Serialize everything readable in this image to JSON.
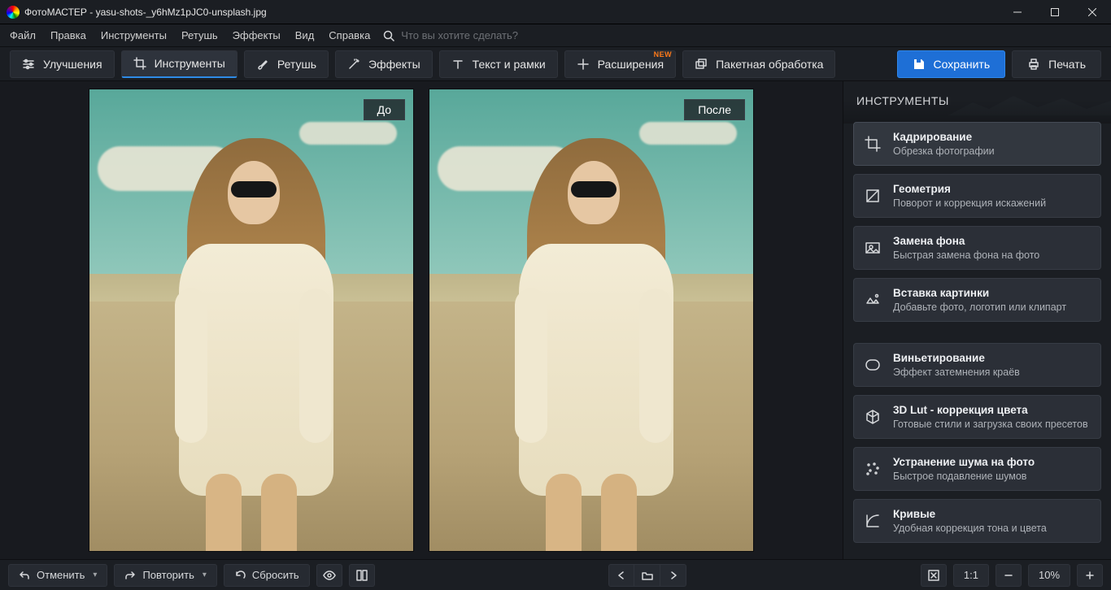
{
  "app": {
    "title": "ФотоМАСТЕР - yasu-shots-_y6hMz1pJC0-unsplash.jpg"
  },
  "menu": {
    "items": [
      "Файл",
      "Правка",
      "Инструменты",
      "Ретушь",
      "Эффекты",
      "Вид",
      "Справка"
    ],
    "search_placeholder": "Что вы хотите сделать?"
  },
  "toolbar": {
    "tabs": [
      {
        "id": "enhance",
        "label": "Улучшения"
      },
      {
        "id": "tools",
        "label": "Инструменты",
        "active": true
      },
      {
        "id": "retouch",
        "label": "Ретушь"
      },
      {
        "id": "effects",
        "label": "Эффекты"
      },
      {
        "id": "textframes",
        "label": "Текст и рамки"
      },
      {
        "id": "extensions",
        "label": "Расширения",
        "badge": "NEW"
      },
      {
        "id": "batch",
        "label": "Пакетная обработка"
      }
    ],
    "save": "Сохранить",
    "print": "Печать"
  },
  "canvas": {
    "before_label": "До",
    "after_label": "После"
  },
  "panel": {
    "heading": "ИНСТРУМЕНТЫ",
    "cards": [
      {
        "id": "crop",
        "title": "Кадрирование",
        "sub": "Обрезка фотографии",
        "active": true,
        "group": 0,
        "icon": "crop"
      },
      {
        "id": "geometry",
        "title": "Геометрия",
        "sub": "Поворот и коррекция искажений",
        "group": 0,
        "icon": "geometry"
      },
      {
        "id": "replace-bg",
        "title": "Замена фона",
        "sub": "Быстрая замена фона на фото",
        "group": 0,
        "icon": "replace-bg"
      },
      {
        "id": "insert-image",
        "title": "Вставка картинки",
        "sub": "Добавьте фото, логотип или клипарт",
        "group": 0,
        "icon": "insert-image"
      },
      {
        "id": "vignette",
        "title": "Виньетирование",
        "sub": "Эффект затемнения краёв",
        "group": 1,
        "icon": "vignette"
      },
      {
        "id": "3dlut",
        "title": "3D Lut - коррекция цвета",
        "sub": "Готовые стили и загрузка своих пресетов",
        "group": 1,
        "icon": "3dlut"
      },
      {
        "id": "denoise",
        "title": "Устранение шума на фото",
        "sub": "Быстрое подавление шумов",
        "group": 1,
        "icon": "denoise"
      },
      {
        "id": "curves",
        "title": "Кривые",
        "sub": "Удобная коррекция тона и цвета",
        "group": 1,
        "icon": "curves"
      }
    ]
  },
  "bottom": {
    "undo": "Отменить",
    "redo": "Повторить",
    "reset": "Сбросить",
    "fit": "1:1",
    "zoom": "10%"
  }
}
